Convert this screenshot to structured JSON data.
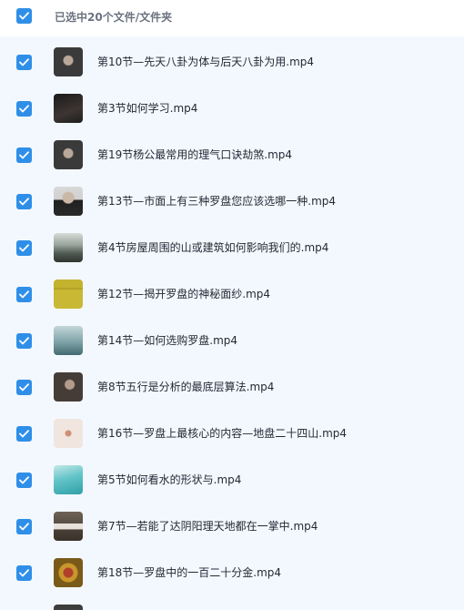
{
  "header": {
    "select_all_checked": true,
    "title": "已选中20个文件/文件夹"
  },
  "files": [
    {
      "name": "第10节—先天八卦为体与后天八卦为用.mp4",
      "checked": true,
      "thumb": "t-dark-person"
    },
    {
      "name": "第3节如何学习.mp4",
      "checked": true,
      "thumb": "t-dark"
    },
    {
      "name": "第19节杨公最常用的理气口诀劫煞.mp4",
      "checked": true,
      "thumb": "t-dark-person"
    },
    {
      "name": "第13节—市面上有三种罗盘您应该选哪一种.mp4",
      "checked": true,
      "thumb": "t-person2"
    },
    {
      "name": "第4节房屋周围的山或建筑如何影响我们的.mp4",
      "checked": true,
      "thumb": "t-mountain"
    },
    {
      "name": "第12节—揭开罗盘的神秘面纱.mp4",
      "checked": true,
      "thumb": "t-yellow"
    },
    {
      "name": "第14节—如何选购罗盘.mp4",
      "checked": true,
      "thumb": "t-teal"
    },
    {
      "name": "第8节五行是分析的最底层算法.mp4",
      "checked": true,
      "thumb": "t-person3"
    },
    {
      "name": "第16节—罗盘上最核心的内容—地盘二十四山.mp4",
      "checked": true,
      "thumb": "t-pale"
    },
    {
      "name": "第5节如何看水的形状与.mp4",
      "checked": true,
      "thumb": "t-pool"
    },
    {
      "name": "第7节—若能了达阴阳理天地都在一掌中.mp4",
      "checked": true,
      "thumb": "t-building"
    },
    {
      "name": "第18节—罗盘中的一百二十分金.mp4",
      "checked": true,
      "thumb": "t-gold"
    },
    {
      "name": "",
      "checked": false,
      "thumb": "t-last"
    }
  ],
  "colors": {
    "checkbox": "#2f8fe8",
    "list_background": "#f3f8fe"
  },
  "icons": {
    "checkbox": "checkmark-icon",
    "thumbnail": "video-thumbnail"
  }
}
